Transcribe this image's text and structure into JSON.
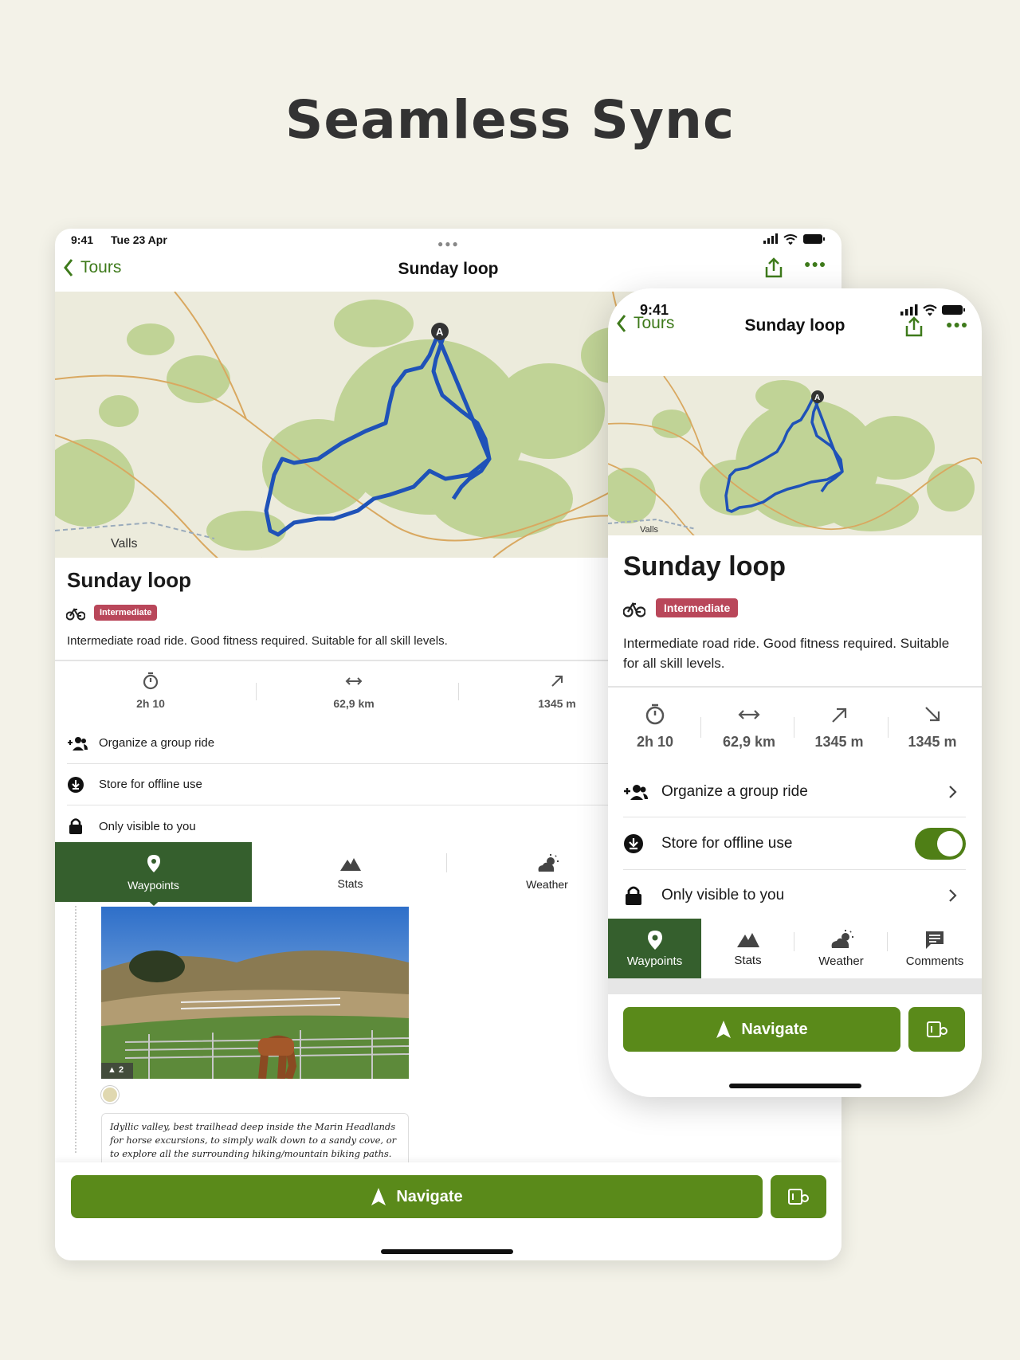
{
  "headline": "Seamless Sync",
  "tablet": {
    "status": {
      "time": "9:41",
      "date": "Tue 23 Apr"
    },
    "nav": {
      "back_label": "Tours",
      "title": "Sunday loop"
    },
    "map_label": "Valls",
    "tour": {
      "title": "Sunday loop",
      "difficulty": "Intermediate",
      "description": "Intermediate road ride. Good fitness required. Suitable for all skill levels."
    },
    "stats": [
      {
        "icon": "timer-icon",
        "value": "2h 10"
      },
      {
        "icon": "distance-icon",
        "value": "62,9 km"
      },
      {
        "icon": "ascent-icon",
        "value": "1345 m"
      }
    ],
    "actions": [
      {
        "icon": "group-add-icon",
        "label": "Organize a group ride"
      },
      {
        "icon": "download-icon",
        "label": "Store for offline use"
      },
      {
        "icon": "lock-icon",
        "label": "Only visible to you"
      }
    ],
    "tabs": [
      {
        "icon": "waypoint-icon",
        "label": "Waypoints",
        "active": true
      },
      {
        "icon": "mountain-icon",
        "label": "Stats",
        "active": false
      },
      {
        "icon": "weather-icon",
        "label": "Weather",
        "active": false
      }
    ],
    "photo_likes": "2",
    "comment": "Idyllic valley, best trailhead deep inside the Marin Headlands for horse excursions, to simply walk down to a sandy cove, or to explore all the surrounding hiking/mountain biking paths.",
    "navigate_label": "Navigate"
  },
  "phone": {
    "status": {
      "time": "9:41"
    },
    "nav": {
      "back_label": "Tours",
      "title": "Sunday loop"
    },
    "map_label": "Valls",
    "tour": {
      "title": "Sunday loop",
      "difficulty": "Intermediate",
      "description": "Intermediate road ride. Good fitness required. Suitable for all skill levels."
    },
    "stats": [
      {
        "icon": "timer-icon",
        "value": "2h 10"
      },
      {
        "icon": "distance-icon",
        "value": "62,9 km"
      },
      {
        "icon": "ascent-icon",
        "value": "1345 m"
      },
      {
        "icon": "descent-icon",
        "value": "1345 m"
      }
    ],
    "actions": [
      {
        "icon": "group-add-icon",
        "label": "Organize a group ride",
        "control": "chevron"
      },
      {
        "icon": "download-icon",
        "label": "Store for offline use",
        "control": "toggle",
        "toggle_on": true
      },
      {
        "icon": "lock-icon",
        "label": "Only visible to you",
        "control": "chevron"
      }
    ],
    "tabs": [
      {
        "icon": "waypoint-icon",
        "label": "Waypoints",
        "active": true
      },
      {
        "icon": "mountain-icon",
        "label": "Stats",
        "active": false
      },
      {
        "icon": "weather-icon",
        "label": "Weather",
        "active": false
      },
      {
        "icon": "comment-icon",
        "label": "Comments",
        "active": false
      }
    ],
    "navigate_label": "Navigate"
  },
  "colors": {
    "accent": "#3e7a1b",
    "button": "#5a8a1a",
    "active_tab": "#355f2d",
    "badge": "#b9475a",
    "route": "#1f52b8",
    "background": "#f3f2e8"
  }
}
